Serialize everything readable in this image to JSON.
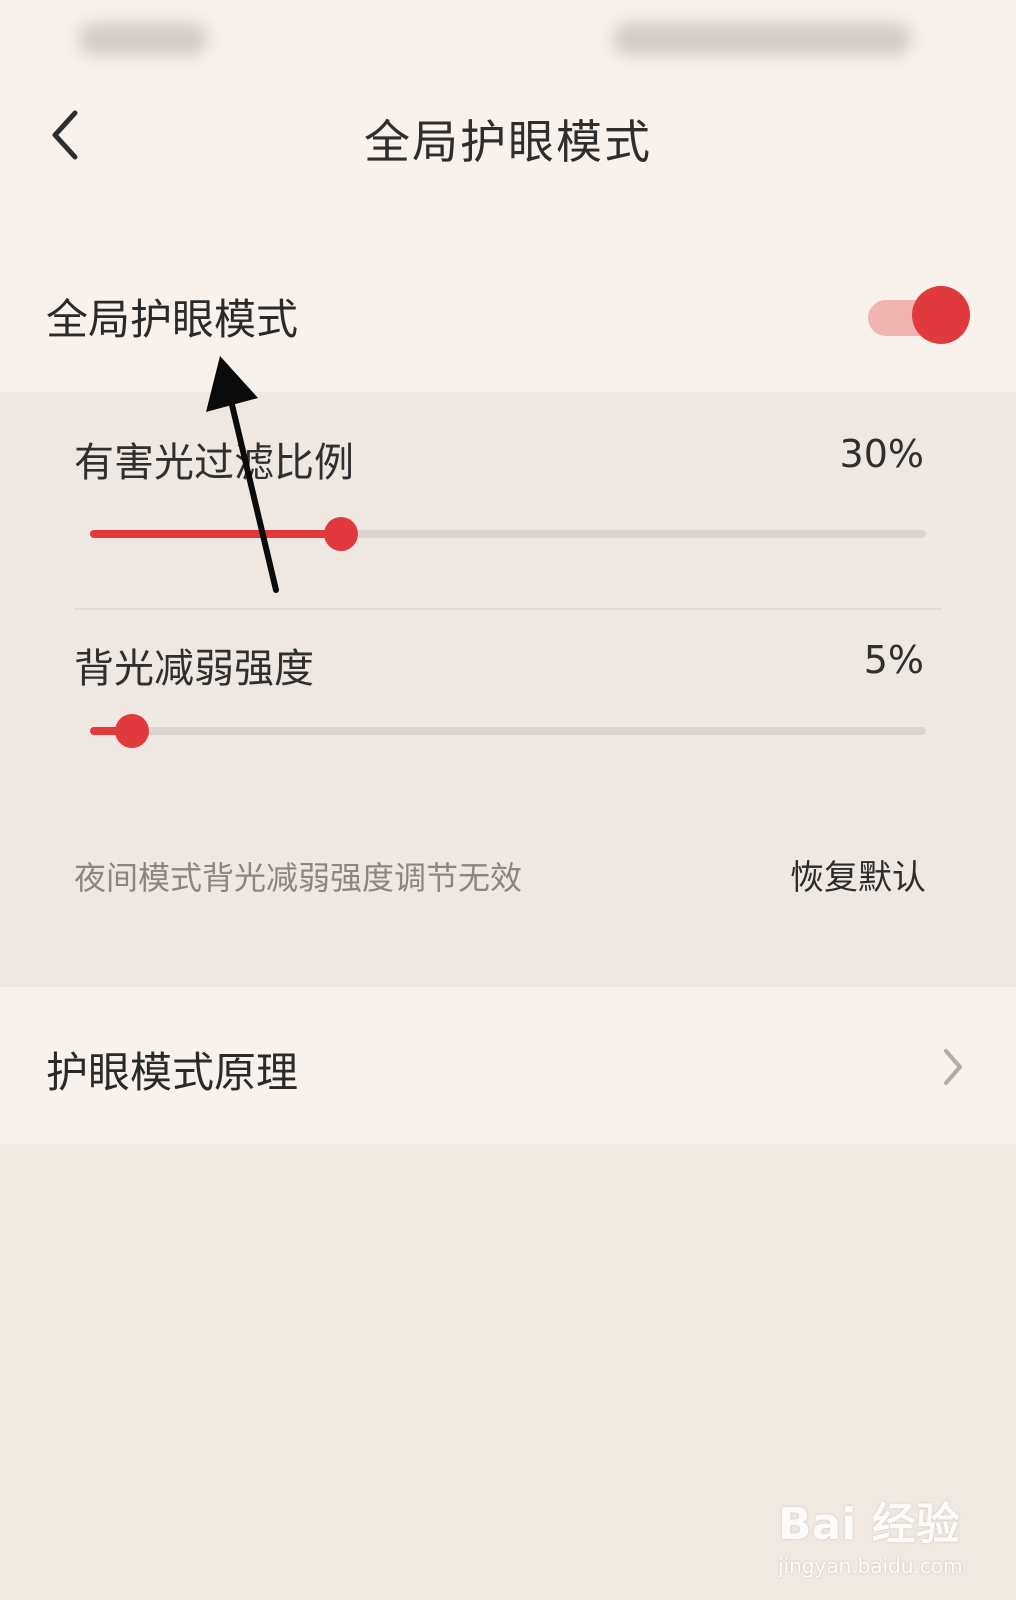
{
  "header": {
    "title": "全局护眼模式",
    "back_icon": "chevron-left-icon"
  },
  "eye_mode": {
    "label": "全局护眼模式",
    "enabled": true
  },
  "filter_slider": {
    "label": "有害光过滤比例",
    "value_text": "30%",
    "level": 0.3
  },
  "backlight_slider": {
    "label": "背光减弱强度",
    "value_text": "5%",
    "level": 0.05
  },
  "hint": {
    "text": "夜间模式背光减弱强度调节无效",
    "restore_label": "恢复默认"
  },
  "principle_link": {
    "label": "护眼模式原理",
    "icon": "chevron-right-icon"
  },
  "watermark": {
    "logo": "Bai 经验",
    "url": "jingyan.baidu.com"
  },
  "colors": {
    "accent": "#e03a3e",
    "accent_light": "#f0b5b2",
    "background": "#f8f1ec",
    "panel": "#efe8e2"
  }
}
